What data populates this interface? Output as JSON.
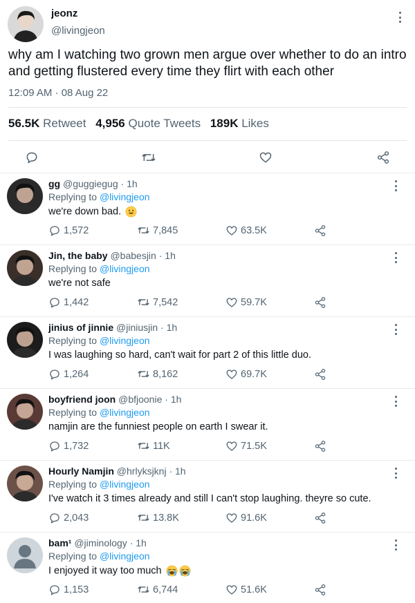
{
  "tweet": {
    "author_name": "jeonz",
    "author_handle": "@livingjeon",
    "text": "why am I watching two grown men argue over whether to do an intro and getting flustered every time they flirt with each other",
    "timestamp": "12:09 AM · 08 Aug 22",
    "stats": {
      "retweets_count": "56.5K",
      "retweets_label": "Retweet",
      "quotes_count": "4,956",
      "quotes_label": "Quote Tweets",
      "likes_count": "189K",
      "likes_label": "Likes"
    }
  },
  "replying_label": "Replying to",
  "replies": [
    {
      "name": "gg",
      "handle": "@guggiegug",
      "time": "· 1h",
      "replying_to": "@livingjeon",
      "text": "we're down bad.",
      "replies": "1,572",
      "retweets": "7,845",
      "likes": "63.5K",
      "emoji": "grinning-face-emoji",
      "avatar_color": "#2a2a2a"
    },
    {
      "name": "Jin, the baby",
      "handle": "@babesjin",
      "time": "· 1h",
      "replying_to": "@livingjeon",
      "text": "we're not safe",
      "replies": "1,442",
      "retweets": "7,542",
      "likes": "59.7K",
      "avatar_color": "#3b2f2a"
    },
    {
      "name": "jinius of jinnie",
      "handle": "@jiniusjin",
      "time": "· 1h",
      "replying_to": "@livingjeon",
      "text": "I was laughing so hard, can't wait for part 2 of this little duo.",
      "replies": "1,264",
      "retweets": "8,162",
      "likes": "69.7K",
      "avatar_color": "#1c1c1c"
    },
    {
      "name": "boyfriend joon",
      "handle": "@bfjoonie",
      "time": "· 1h",
      "replying_to": "@livingjeon",
      "text": "namjin are the funniest people on earth I swear it.",
      "replies": "1,732",
      "retweets": "11K",
      "likes": "71.5K",
      "avatar_color": "#5a3a35"
    },
    {
      "name": "Hourly Namjin",
      "handle": "@hrlyksjknj",
      "time": "· 1h",
      "replying_to": "@livingjeon",
      "text": "I've watch it 3 times already and still I can't stop laughing. theyre so cute.",
      "replies": "2,043",
      "retweets": "13.8K",
      "likes": "91.6K",
      "avatar_color": "#6b5148"
    },
    {
      "name": "bam¹",
      "handle": "@jiminology",
      "time": "· 1h",
      "replying_to": "@livingjeon",
      "text": "I enjoyed it way too much",
      "replies": "1,153",
      "retweets": "6,744",
      "likes": "51.6K",
      "emoji": "crying-face-emoji-x2",
      "avatar_color": "#ced5db"
    }
  ],
  "colors": {
    "accent": "#1d9bf0",
    "secondary_text": "#536471",
    "primary_text": "#0f1419"
  }
}
